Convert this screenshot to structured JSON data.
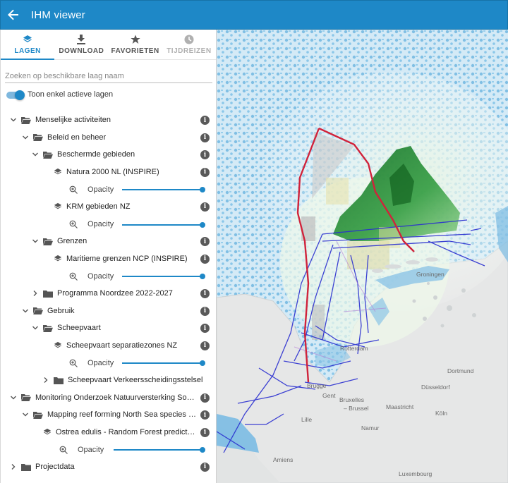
{
  "app": {
    "title": "IHM viewer",
    "accent": "#1e88c7"
  },
  "tabs": [
    {
      "label": "LAGEN",
      "icon": "layers-icon",
      "state": "active"
    },
    {
      "label": "DOWNLOAD",
      "icon": "download-icon",
      "state": "normal"
    },
    {
      "label": "FAVORIETEN",
      "icon": "star-icon",
      "state": "normal"
    },
    {
      "label": "TIJDREIZEN",
      "icon": "clock-icon",
      "state": "disabled"
    }
  ],
  "search": {
    "placeholder": "Zoeken op beschikbare laag naam",
    "value": ""
  },
  "toggle": {
    "label": "Toon enkel actieve lagen",
    "on": true
  },
  "tree": {
    "r0": "Menselijke activiteiten",
    "r1": "Beleid en beheer",
    "r2": "Beschermde gebieden",
    "r3": "Natura 2000 NL (INSPIRE)",
    "r4": "Opacity",
    "r5": "KRM gebieden NZ",
    "r6": "Opacity",
    "r7": "Grenzen",
    "r8": "Maritieme grenzen NCP (INSPIRE)",
    "r9": "Opacity",
    "r10": "Programma Noordzee 2022-2027",
    "r11": "Gebruik",
    "r12": "Scheepvaart",
    "r13": "Scheepvaart separatiezones NZ",
    "r14": "Opacity",
    "r15": "Scheepvaart Verkeersscheidingsstelsel",
    "r16": "Monitoring Onderzoek Natuurversterking Soortenbescherming",
    "r17": "Mapping reef forming North Sea species - Delta",
    "r18": "Ostrea edulis - Random Forest prediction M",
    "r19": "Opacity",
    "r20": "Projectdata"
  },
  "map": {
    "labels": {
      "groningen": "Groningen",
      "rotterdam": "Rotterdam",
      "brugge": "Brugge",
      "gent": "Gent",
      "bruxelles": "Bruxelles",
      "brussel": "– Brussel",
      "namur": "Namur",
      "lille": "Lille",
      "amiens": "Amiens",
      "dortmund": "Dortmund",
      "dusseldorf": "Düsseldorf",
      "koln": "Köln",
      "maastricht": "Maastricht",
      "luxembourg": "Luxembourg"
    },
    "colors": {
      "sea": "#6fb7e1",
      "land": "#e6e7e7",
      "habitat": "#2e9a3c",
      "boundary": "#d0233b",
      "shipping": "#2a2fd0"
    }
  }
}
